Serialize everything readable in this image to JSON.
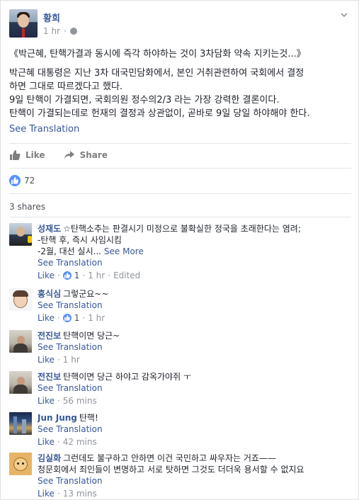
{
  "post": {
    "author": "황희",
    "time": "1 hr",
    "privacy_icon": "globe-icon",
    "menu_icon": "chevron-down-icon",
    "lines": [
      "《박근혜, 탄핵가결과 동시에 즉각 하야하는 것이 3차담화 약속 지키는것...》",
      "박근혜 대통령은 지난 3차 대국민담화에서, 본인 거취관련하여 국회에서 결정",
      "하면 그대로 따르겠다고 했다.",
      "9일 탄핵이 가결되면, 국회의원 정수의2/3 라는 가장 강력한 결론이다.",
      "탄핵이 가결되는데로 헌재의 결정과 상관없이, 곧바로 9일 당일 하야해야 한다."
    ],
    "see_translation": "See Translation"
  },
  "actions": {
    "like": "Like",
    "share": "Share"
  },
  "reactions": {
    "count": "72"
  },
  "shares": "3 shares",
  "comments": [
    {
      "name": "성재도",
      "text": "☆탄핵소추는 판결시기 미정으로 불확실한 정국을 초래한다는 염려;",
      "extra_lines": [
        "-탄핵 후, 즉시 사임시킴"
      ],
      "tail": "-2월, 대선 실시...",
      "see_more": "See More",
      "see_translation": "See Translation",
      "like": "Like",
      "likes": "1",
      "time": "1 hr",
      "edited": "Edited"
    },
    {
      "name": "흥식심",
      "text": "그렇군요~~",
      "see_translation": "See Translation",
      "like": "Like",
      "likes": "1",
      "time": "1 hr"
    },
    {
      "name": "전진보",
      "text": "탄핵이면 당근~",
      "see_translation": "See Translation",
      "like": "Like",
      "time": "1 hr"
    },
    {
      "name": "전진보",
      "text": "탄핵이면 당근 하야고 감옥가야쥐 ㅜ",
      "see_translation": "See Translation",
      "like": "Like",
      "time": "56 mins"
    },
    {
      "name": "Jun Jung",
      "text": "탄핵!",
      "see_translation": "See Translation",
      "like": "Like",
      "time": "42 mins"
    },
    {
      "name": "김실화",
      "text": "그런데도 불구하고 안하면 이건 국민하고 싸우자는 거죠——",
      "extra_lines": [
        "청문회에서 죄인들이 변명하고 서로 탓하면 그것도 더더욱 용서할 수 없지요"
      ],
      "see_translation": "See Translation",
      "like": "Like",
      "time": "13 mins"
    }
  ],
  "colors": {
    "link": "#365899",
    "meta": "#90949c",
    "like_blue": "#5890ff"
  }
}
